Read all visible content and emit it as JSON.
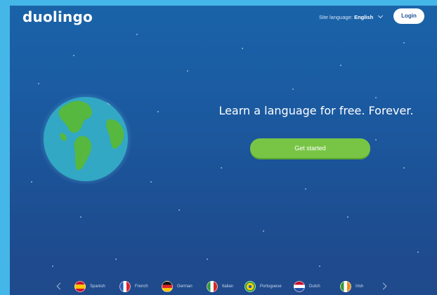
{
  "header": {
    "logo": "duolingo",
    "site_language_label": "Site language:",
    "site_language_value": "English",
    "login_label": "Login"
  },
  "hero": {
    "headline": "Learn a language for free. Forever.",
    "cta_label": "Get started"
  },
  "languages": [
    {
      "name": "Spanish",
      "flag": "spain-flag"
    },
    {
      "name": "French",
      "flag": "france-flag"
    },
    {
      "name": "German",
      "flag": "germany-flag"
    },
    {
      "name": "Italian",
      "flag": "italy-flag"
    },
    {
      "name": "Portuguese",
      "flag": "brazil-flag"
    },
    {
      "name": "Dutch",
      "flag": "netherlands-flag"
    },
    {
      "name": "Irish",
      "flag": "ireland-flag"
    }
  ],
  "colors": {
    "background_top": "#1a63a9",
    "background_bottom": "#20488b",
    "frame": "#45b6e8",
    "cta_green": "#78c545",
    "globe_ocean": "#32a8c4",
    "globe_land": "#56b83e"
  }
}
